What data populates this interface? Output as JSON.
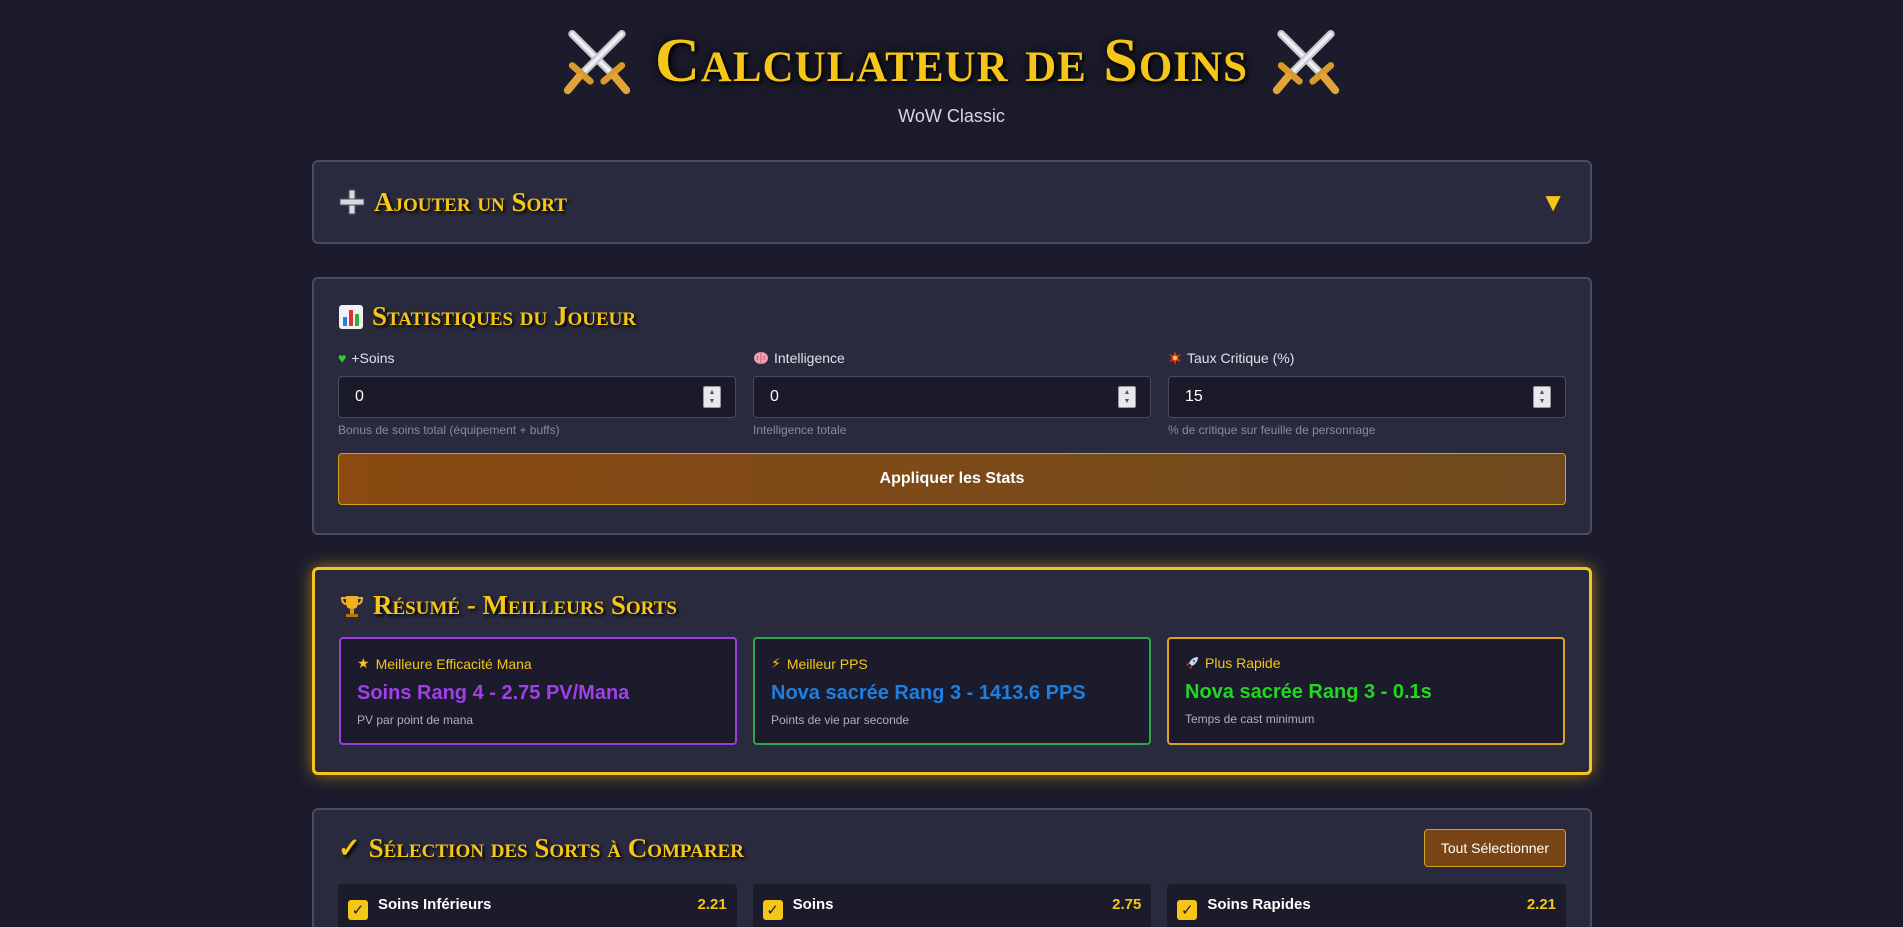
{
  "header": {
    "title": "Calculateur de Soins",
    "subtitle": "WoW Classic",
    "left_icon": "crossed-swords-icon",
    "right_icon": "crossed-swords-icon"
  },
  "add_spell": {
    "title": "Ajouter un Sort",
    "icon": "plus-icon",
    "toggle_icon": "caret-down-icon"
  },
  "stats": {
    "title": "Statistiques du Joueur",
    "icon": "bar-chart-icon",
    "fields": [
      {
        "label": "+Soins",
        "icon": "green-heart-icon",
        "value": "0",
        "hint": "Bonus de soins total (équipement + buffs)"
      },
      {
        "label": "Intelligence",
        "icon": "brain-icon",
        "value": "0",
        "hint": "Intelligence totale"
      },
      {
        "label": "Taux Critique (%)",
        "icon": "collision-icon",
        "value": "15",
        "hint": "% de critique sur feuille de personnage"
      }
    ],
    "apply_label": "Appliquer les Stats"
  },
  "summary": {
    "title": "Résumé - Meilleurs Sorts",
    "icon": "trophy-icon",
    "cards": [
      {
        "label": "Meilleure Efficacité Mana",
        "icon": "star-icon",
        "value": "Soins Rang 4 - 2.75 PV/Mana",
        "desc": "PV par point de mana",
        "color": "#a040e8"
      },
      {
        "label": "Meilleur PPS",
        "icon": "lightning-icon",
        "value": "Nova sacrée Rang 3 - 1413.6 PPS",
        "desc": "Points de vie par seconde",
        "color": "#1e7fe0"
      },
      {
        "label": "Plus Rapide",
        "icon": "rocket-icon",
        "value": "Nova sacrée Rang 3 - 0.1s",
        "desc": "Temps de cast minimum",
        "color": "#22d622"
      }
    ],
    "card_borders": [
      "#9b3ee0",
      "#2aa84a",
      "#e0a020"
    ]
  },
  "selection": {
    "title": "Sélection des Sorts à Comparer",
    "icon": "check-mark-icon",
    "select_all_label": "Tout Sélectionner",
    "spells": [
      {
        "name": "Soins Inférieurs",
        "ratio": "2.21",
        "checked": true
      },
      {
        "name": "Soins",
        "ratio": "2.75",
        "checked": true
      },
      {
        "name": "Soins Rapides",
        "ratio": "2.21",
        "checked": true
      }
    ]
  },
  "colors": {
    "background": "#1b1b2b",
    "panel": "#2a2a3e",
    "accent_gold": "#f5c518",
    "button_brown": "#8a4a12"
  }
}
